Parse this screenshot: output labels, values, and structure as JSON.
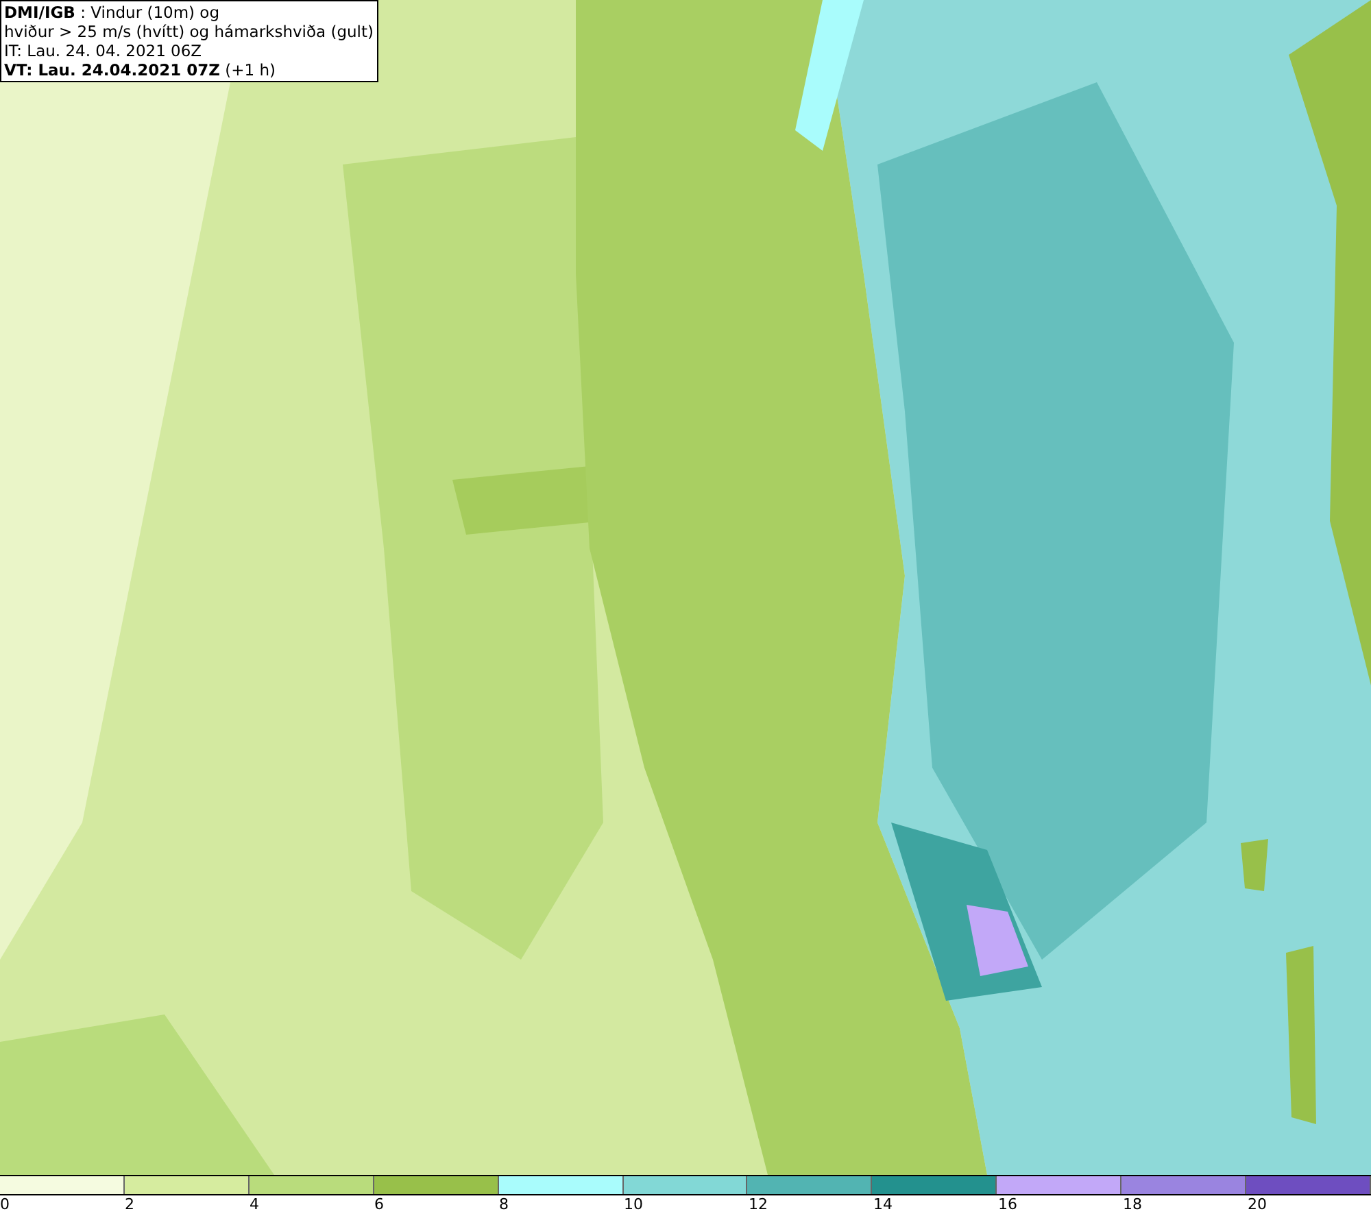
{
  "title_box": {
    "lines": [
      "**DMI/IGB** : Vindur (10m) og",
      "hviður > 25 m/s (hvítt) og hámarkshviða (gult)",
      "IT: Lau. 24. 04. 2021 06Z",
      "**VT: Lau. 24.04.2021 07Z** (+1 h)"
    ]
  },
  "legend": {
    "bins": [
      {
        "color": "#f5fbe0"
      },
      {
        "color": "#d6ec9f"
      },
      {
        "color": "#b9dc7c"
      },
      {
        "color": "#98c04a"
      },
      {
        "color": "#a9fcfc"
      },
      {
        "color": "#82d8d6"
      },
      {
        "color": "#52b4b2"
      },
      {
        "color": "#23918e"
      },
      {
        "color": "#c2a8f8"
      },
      {
        "color": "#9a84e0"
      },
      {
        "color": "#6e4ec0"
      }
    ],
    "ticks": [
      "0",
      "2",
      "4",
      "6",
      "8",
      "10",
      "12",
      "14",
      "16",
      "18",
      "20"
    ]
  }
}
